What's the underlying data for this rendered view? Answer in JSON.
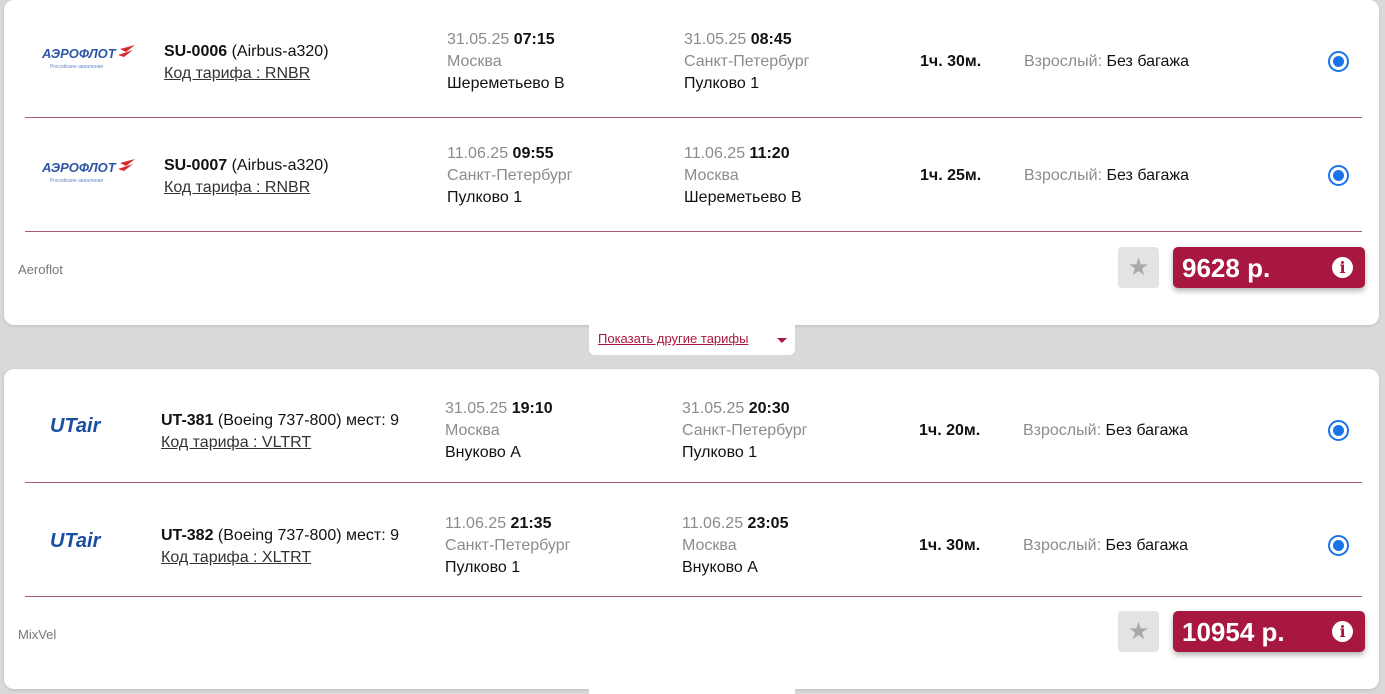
{
  "offers": [
    {
      "provider": "Aeroflot",
      "price": "9628 р.",
      "segments": [
        {
          "airline_logo": "aeroflot-logo",
          "flight_number": "SU-0006",
          "aircraft": " (Airbus-a320)",
          "tariff": "Код тарифа : RNBR",
          "dep_date": "31.05.25",
          "dep_time": "07:15",
          "dep_city": "Москва",
          "dep_airport": "Шереметьево B",
          "arr_date": "31.05.25",
          "arr_time": "08:45",
          "arr_city": "Санкт-Петербург",
          "arr_airport": "Пулково 1",
          "duration": "1ч. 30м.",
          "pax_label": "Взрослый:",
          "baggage": "Без багажа"
        },
        {
          "airline_logo": "aeroflot-logo",
          "flight_number": "SU-0007",
          "aircraft": " (Airbus-a320)",
          "tariff": "Код тарифа : RNBR",
          "dep_date": "11.06.25",
          "dep_time": "09:55",
          "dep_city": "Санкт-Петербург",
          "dep_airport": "Пулково 1",
          "arr_date": "11.06.25",
          "arr_time": "11:20",
          "arr_city": "Москва",
          "arr_airport": "Шереметьево B",
          "duration": "1ч. 25м.",
          "pax_label": "Взрослый:",
          "baggage": "Без багажа"
        }
      ]
    },
    {
      "provider": "MixVel",
      "price": "10954 р.",
      "segments": [
        {
          "airline_logo": "utair-logo",
          "flight_number": "UT-381",
          "aircraft": " (Boeing 737-800) мест: 9",
          "tariff": "Код тарифа : VLTRT",
          "dep_date": "31.05.25",
          "dep_time": "19:10",
          "dep_city": "Москва",
          "dep_airport": "Внуково A",
          "arr_date": "31.05.25",
          "arr_time": "20:30",
          "arr_city": "Санкт-Петербург",
          "arr_airport": "Пулково 1",
          "duration": "1ч. 20м.",
          "pax_label": "Взрослый:",
          "baggage": "Без багажа"
        },
        {
          "airline_logo": "utair-logo",
          "flight_number": "UT-382",
          "aircraft": " (Boeing 737-800) мест: 9",
          "tariff": "Код тарифа : XLTRT",
          "dep_date": "11.06.25",
          "dep_time": "21:35",
          "dep_city": "Санкт-Петербург",
          "dep_airport": "Пулково 1",
          "arr_date": "11.06.25",
          "arr_time": "23:05",
          "arr_city": "Москва",
          "arr_airport": "Внуково A",
          "duration": "1ч. 30м.",
          "pax_label": "Взрослый:",
          "baggage": "Без багажа"
        }
      ]
    }
  ],
  "show_more_label": "Показать другие тарифы",
  "logos": {
    "aeroflot_text": "АЭРОФЛОТ",
    "aeroflot_sub": "Российские авиалинии",
    "utair_text": "UTair"
  },
  "icons": {
    "favorite": "star-icon",
    "info": "info-icon",
    "expand": "caret-down-icon"
  },
  "colors": {
    "accent": "#a8173f",
    "radio": "#1a73e8",
    "divider": "#a8587a"
  }
}
